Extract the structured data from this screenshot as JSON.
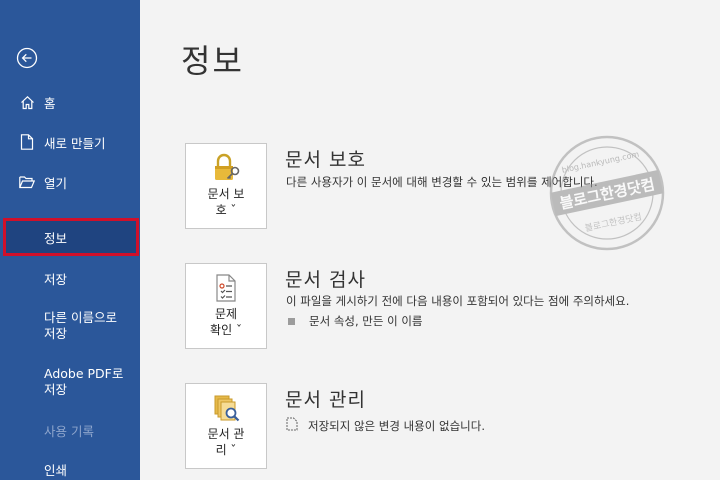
{
  "sidebar": {
    "items": [
      {
        "label": "홈"
      },
      {
        "label": "새로 만들기"
      },
      {
        "label": "열기"
      },
      {
        "label": "정보"
      },
      {
        "label": "저장"
      },
      {
        "label": "다른 이름으로\n저장"
      },
      {
        "label": "Adobe PDF로\n저장"
      },
      {
        "label": "사용 기록"
      },
      {
        "label": "인쇄"
      }
    ]
  },
  "page": {
    "title": "정보"
  },
  "sections": [
    {
      "button_label": "문서 보\n호 ˇ",
      "title": "문서 보호",
      "description": "다른 사용자가 이 문서에 대해 변경할 수 있는 범위를 제어합니다."
    },
    {
      "button_label": "문제\n확인 ˇ",
      "title": "문서 검사",
      "description": "이 파일을 게시하기 전에 다음 내용이 포함되어 있다는 점에 주의하세요.",
      "bullet": "문서 속성, 만든 이 이름"
    },
    {
      "button_label": "문서 관\n리 ˇ",
      "title": "문서 관리",
      "bullet": "저장되지 않은 변경 내용이 없습니다."
    }
  ],
  "watermark": {
    "text": "블로그한경닷컴",
    "url": "https://blog.hankyung.com"
  },
  "colors": {
    "sidebar": "#2b579a",
    "active_item": "#1f4480",
    "highlight_border": "#d0102a",
    "background": "#f3f3f3"
  }
}
